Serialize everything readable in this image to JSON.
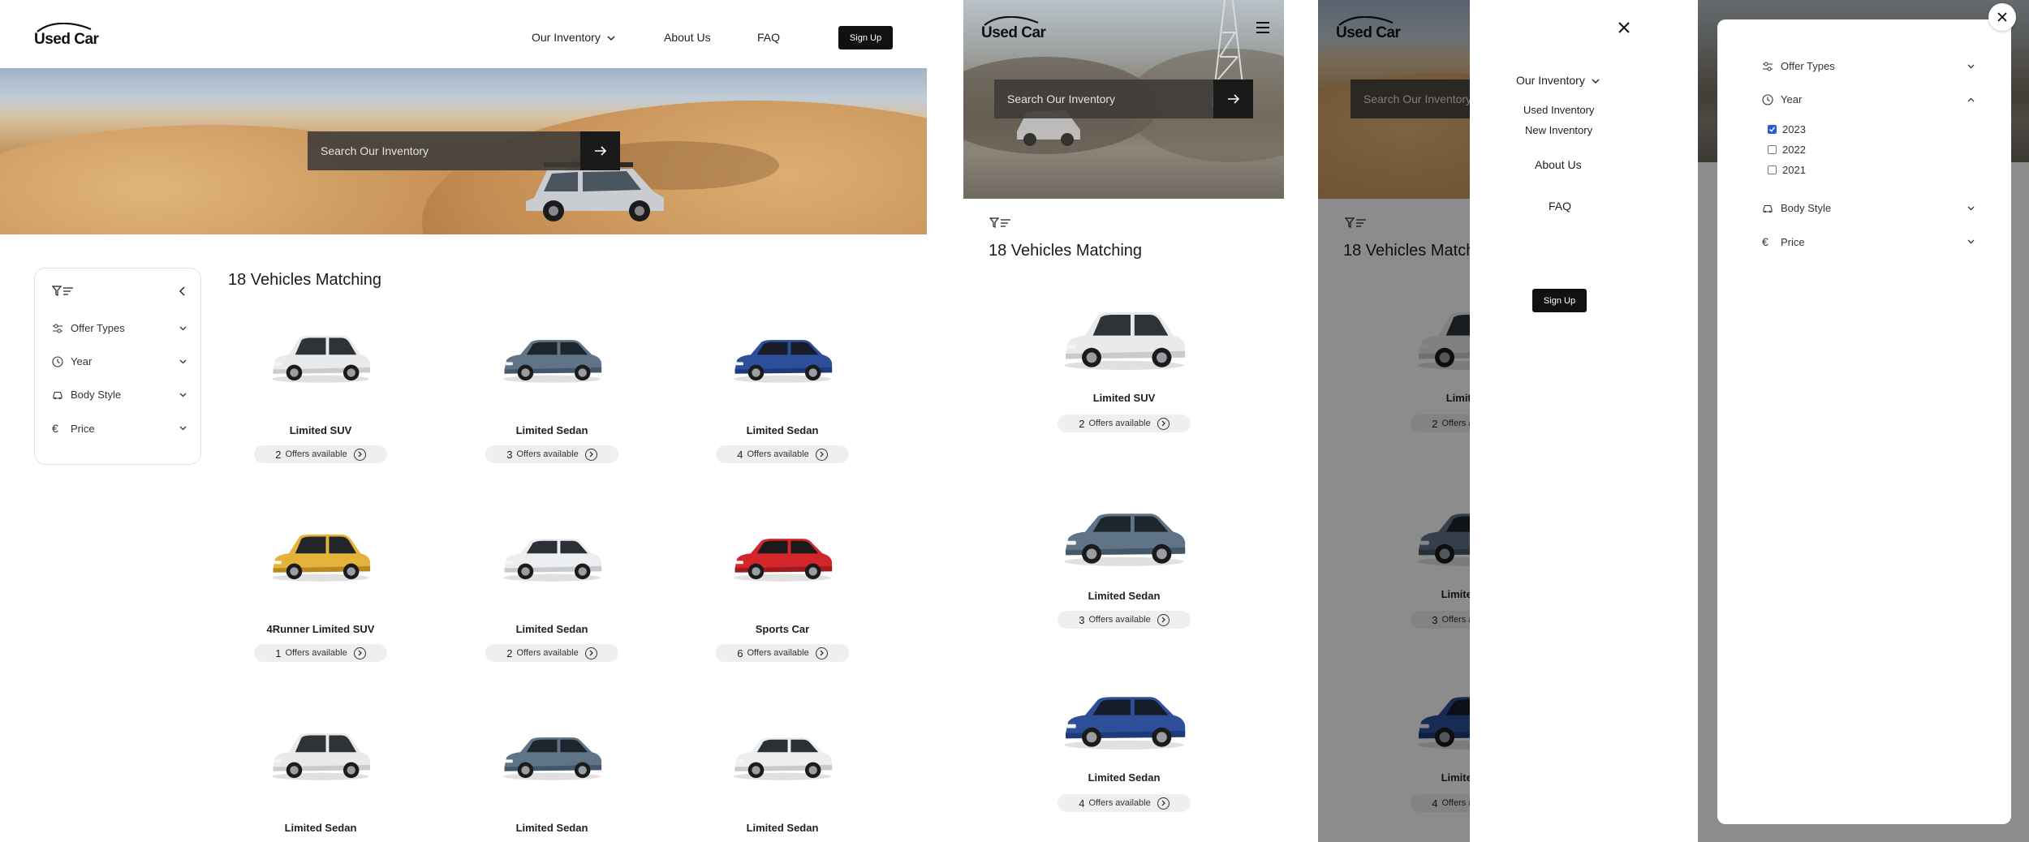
{
  "brand": {
    "logo_text": "Used Car"
  },
  "nav": {
    "inventory": "Our Inventory",
    "about": "About Us",
    "faq": "FAQ",
    "signup": "Sign Up",
    "submenu": [
      "Used Inventory",
      "New Inventory"
    ]
  },
  "search": {
    "placeholder": "Search Our Inventory"
  },
  "filters": {
    "offer_types": "Offer Types",
    "year": "Year",
    "body_style": "Body Style",
    "price": "Price",
    "years": [
      {
        "label": "2023",
        "checked": true
      },
      {
        "label": "2022",
        "checked": false
      },
      {
        "label": "2021",
        "checked": false
      }
    ]
  },
  "results": {
    "title": "18 Vehicles Matching",
    "offers_text": "Offers available",
    "cards": [
      {
        "name": "Limited SUV",
        "offers": "2",
        "car": "white-suv"
      },
      {
        "name": "Limited Sedan",
        "offers": "3",
        "car": "grey-sedan"
      },
      {
        "name": "Limited Sedan",
        "offers": "4",
        "car": "blue-sedan"
      },
      {
        "name": "4Runner Limited SUV",
        "offers": "1",
        "car": "yellow-suv"
      },
      {
        "name": "Limited Sedan",
        "offers": "2",
        "car": "white-coupe"
      },
      {
        "name": "Sports Car",
        "offers": "6",
        "car": "red-sports"
      },
      {
        "name": "Limited Sedan",
        "offers": "",
        "car": "white-suv"
      },
      {
        "name": "Limited Sedan",
        "offers": "",
        "car": "grey-sedan"
      },
      {
        "name": "Limited Sedan",
        "offers": "",
        "car": "white-coupe"
      }
    ]
  },
  "colors": {
    "accent": "#111111",
    "checkbox": "#2c5bd6",
    "pill_bg": "#efefef",
    "overlay": "#000000"
  }
}
